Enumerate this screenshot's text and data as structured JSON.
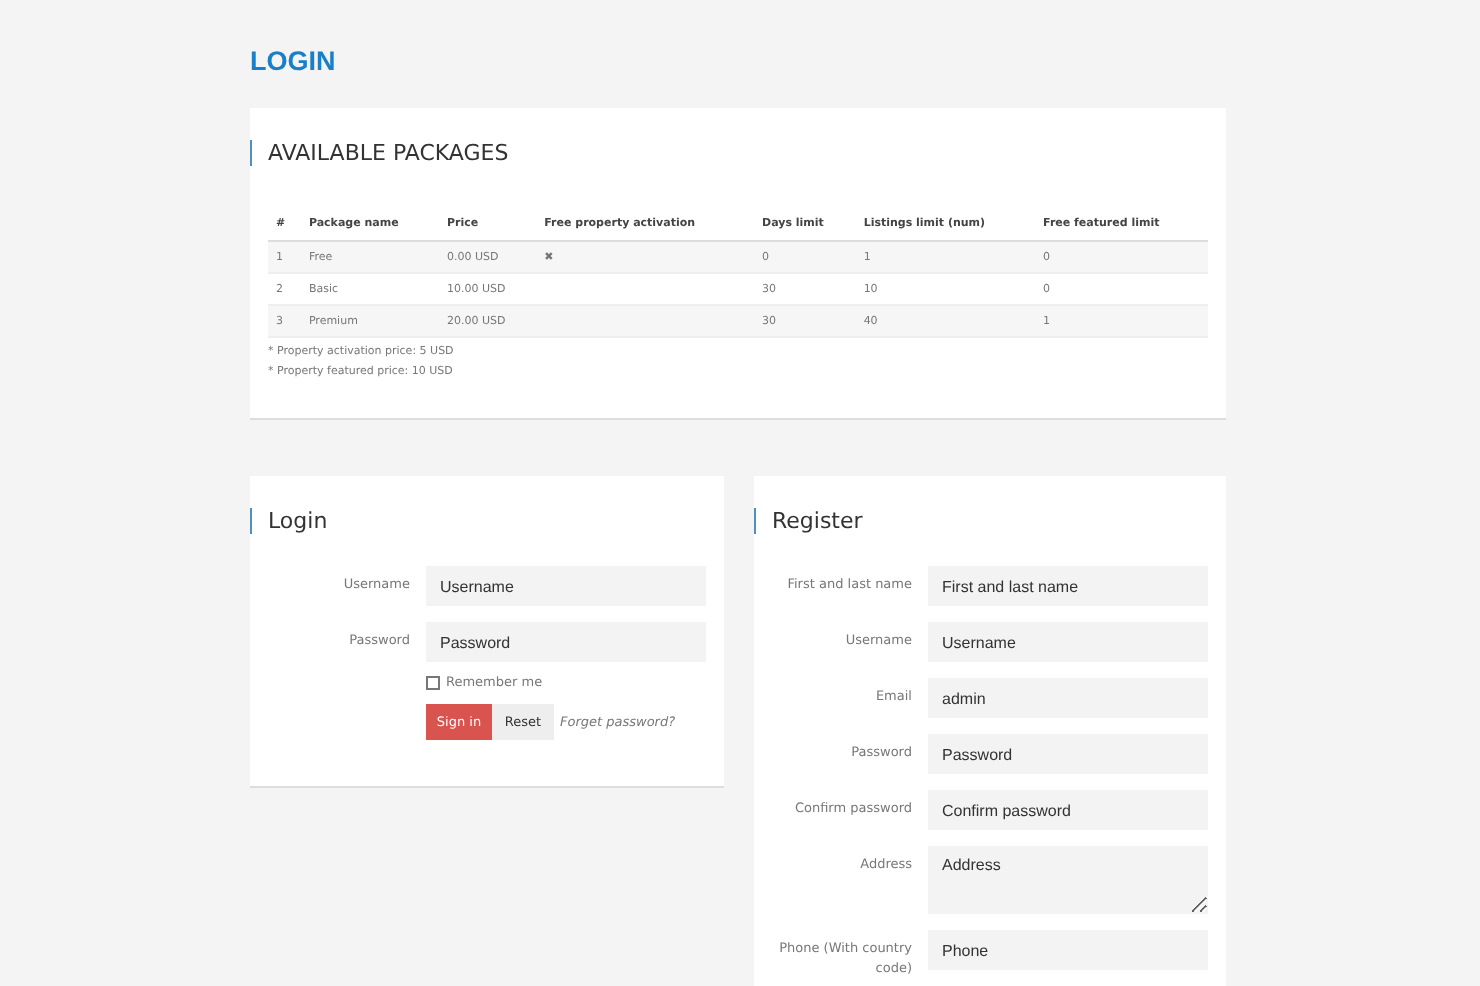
{
  "page_title": "LOGIN",
  "packages": {
    "title": "AVAILABLE PACKAGES",
    "columns": [
      "#",
      "Package name",
      "Price",
      "Free property activation",
      "Days limit",
      "Listings limit (num)",
      "Free featured limit"
    ],
    "rows": [
      {
        "cells": [
          "1",
          "Free",
          "0.00 USD",
          "✖",
          "0",
          "1",
          "0"
        ]
      },
      {
        "cells": [
          "2",
          "Basic",
          "10.00 USD",
          "",
          "30",
          "10",
          "0"
        ]
      },
      {
        "cells": [
          "3",
          "Premium",
          "20.00 USD",
          "",
          "30",
          "40",
          "1"
        ]
      }
    ],
    "notes": [
      "* Property activation price: 5 USD",
      "* Property featured price: 10 USD"
    ]
  },
  "login": {
    "title": "Login",
    "fields": [
      {
        "label": "Username",
        "placeholder": "Username",
        "kind": "text"
      },
      {
        "label": "Password",
        "placeholder": "Password",
        "kind": "text"
      }
    ],
    "remember": {
      "label": "Remember me",
      "checked": false
    },
    "sign_in": "Sign in",
    "reset": "Reset",
    "forgot": "Forget password?"
  },
  "register": {
    "title": "Register",
    "fields": [
      {
        "label": "First and last name",
        "placeholder": "First and last name",
        "kind": "text"
      },
      {
        "label": "Username",
        "placeholder": "Username",
        "kind": "text"
      },
      {
        "label": "Email",
        "value": "admin",
        "kind": "text"
      },
      {
        "label": "Password",
        "placeholder": "Password",
        "kind": "text"
      },
      {
        "label": "Confirm password",
        "placeholder": "Confirm password",
        "kind": "text"
      },
      {
        "label": "Address",
        "placeholder": "Address",
        "kind": "textarea"
      },
      {
        "label": "Phone (With country code)",
        "placeholder": "Phone",
        "kind": "text"
      }
    ]
  }
}
